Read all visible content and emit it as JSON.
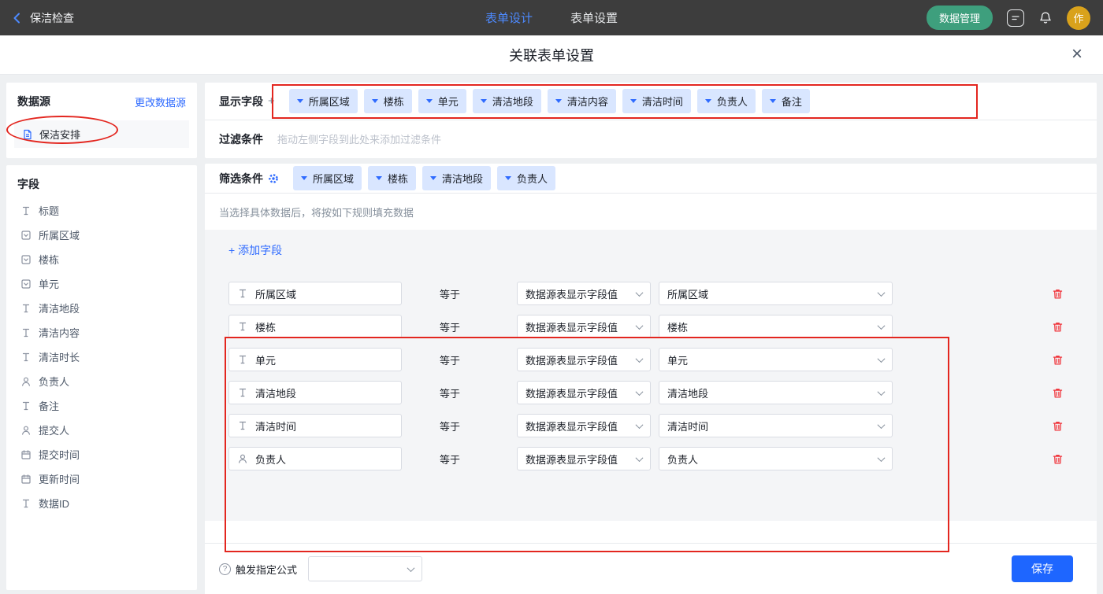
{
  "topbar": {
    "back_label": "保洁检查",
    "tabs": [
      {
        "label": "表单设计",
        "active": true
      },
      {
        "label": "表单设置",
        "active": false
      }
    ],
    "data_manage_button": "数据管理",
    "avatar_text": "作"
  },
  "modal": {
    "title": "关联表单设置",
    "close": "×"
  },
  "sidebar": {
    "datasource": {
      "title": "数据源",
      "change_link": "更改数据源",
      "item": "保洁安排"
    },
    "fields": {
      "title": "字段",
      "items": [
        {
          "icon": "text",
          "label": "标题"
        },
        {
          "icon": "select",
          "label": "所属区域"
        },
        {
          "icon": "select",
          "label": "楼栋"
        },
        {
          "icon": "select",
          "label": "单元"
        },
        {
          "icon": "text",
          "label": "清洁地段"
        },
        {
          "icon": "text",
          "label": "清洁内容"
        },
        {
          "icon": "text",
          "label": "清洁时长"
        },
        {
          "icon": "person",
          "label": "负责人"
        },
        {
          "icon": "text",
          "label": "备注"
        },
        {
          "icon": "person",
          "label": "提交人"
        },
        {
          "icon": "calendar",
          "label": "提交时间"
        },
        {
          "icon": "calendar",
          "label": "更新时间"
        },
        {
          "icon": "text",
          "label": "数据ID"
        }
      ]
    }
  },
  "main": {
    "display_fields": {
      "label": "显示字段",
      "add": "+",
      "tags": [
        "所属区域",
        "楼栋",
        "单元",
        "清洁地段",
        "清洁内容",
        "清洁时间",
        "负责人",
        "备注"
      ]
    },
    "filter": {
      "label": "过滤条件",
      "placeholder": "拖动左侧字段到此处来添加过滤条件"
    },
    "screen": {
      "label": "筛选条件",
      "tags": [
        "所属区域",
        "楼栋",
        "清洁地段",
        "负责人"
      ]
    },
    "hint": "当选择具体数据后，将按如下规则填充数据",
    "add_field": "+ 添加字段",
    "rules": [
      {
        "icon": "text",
        "field": "所属区域",
        "op": "等于",
        "source": "数据源表显示字段值",
        "value": "所属区域"
      },
      {
        "icon": "text",
        "field": "楼栋",
        "op": "等于",
        "source": "数据源表显示字段值",
        "value": "楼栋"
      },
      {
        "icon": "text",
        "field": "单元",
        "op": "等于",
        "source": "数据源表显示字段值",
        "value": "单元"
      },
      {
        "icon": "text",
        "field": "清洁地段",
        "op": "等于",
        "source": "数据源表显示字段值",
        "value": "清洁地段"
      },
      {
        "icon": "text",
        "field": "清洁时间",
        "op": "等于",
        "source": "数据源表显示字段值",
        "value": "清洁时间"
      },
      {
        "icon": "person",
        "field": "负责人",
        "op": "等于",
        "source": "数据源表显示字段值",
        "value": "负责人"
      }
    ],
    "footer": {
      "help": "?",
      "formula_label": "触发指定公式",
      "save_button": "保存"
    }
  },
  "colors": {
    "accent_blue": "#2f6bff",
    "tag_bg": "#d9e6ff",
    "green_button": "#3e9f7d",
    "avatar_bg": "#d9a21b",
    "annotation_red": "#e3261f",
    "trash_red": "#f0383f",
    "save_blue": "#1e66ff",
    "topbar_bg": "#3d3d3d"
  }
}
